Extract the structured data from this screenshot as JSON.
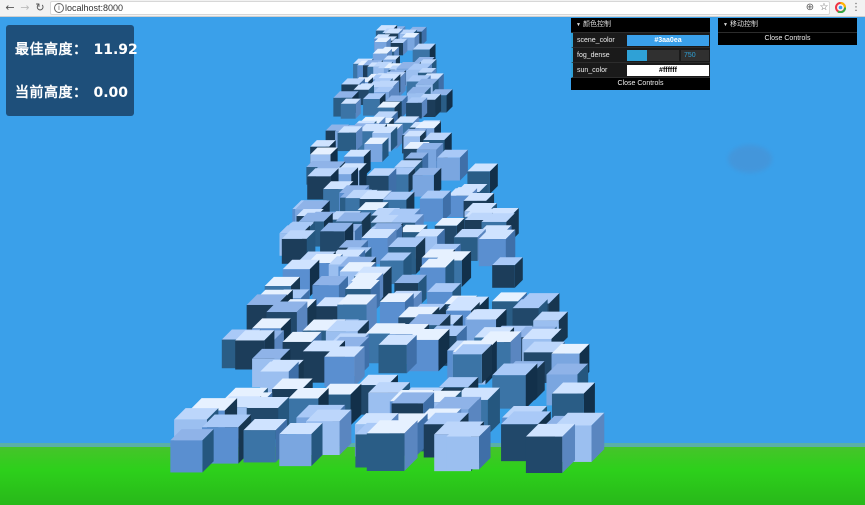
{
  "browser": {
    "url": "localhost:8000",
    "back_icon": "back-arrow-icon",
    "forward_icon": "forward-arrow-icon",
    "reload_icon": "reload-icon"
  },
  "height_panel": {
    "best_label": "最佳高度：",
    "best_value": "11.92",
    "current_label": "当前高度：",
    "current_value": "0.00"
  },
  "color_gui": {
    "title": "颜色控制",
    "scene_color_label": "scene_color",
    "scene_color_value": "#3aa0ea",
    "fog_dense_label": "fog_dense",
    "fog_dense_value": "750",
    "fog_dense_fraction": 0.38,
    "sun_color_label": "sun_color",
    "sun_color_value": "#ffffff",
    "close_label": "Close Controls"
  },
  "move_gui": {
    "title": "移动控制",
    "close_label": "Close Controls"
  },
  "colors": {
    "sky": "#3aa0ea",
    "ground": "#2dd01b",
    "panel": "#1e4f7a",
    "gui_accent": "#2fa1d6"
  }
}
